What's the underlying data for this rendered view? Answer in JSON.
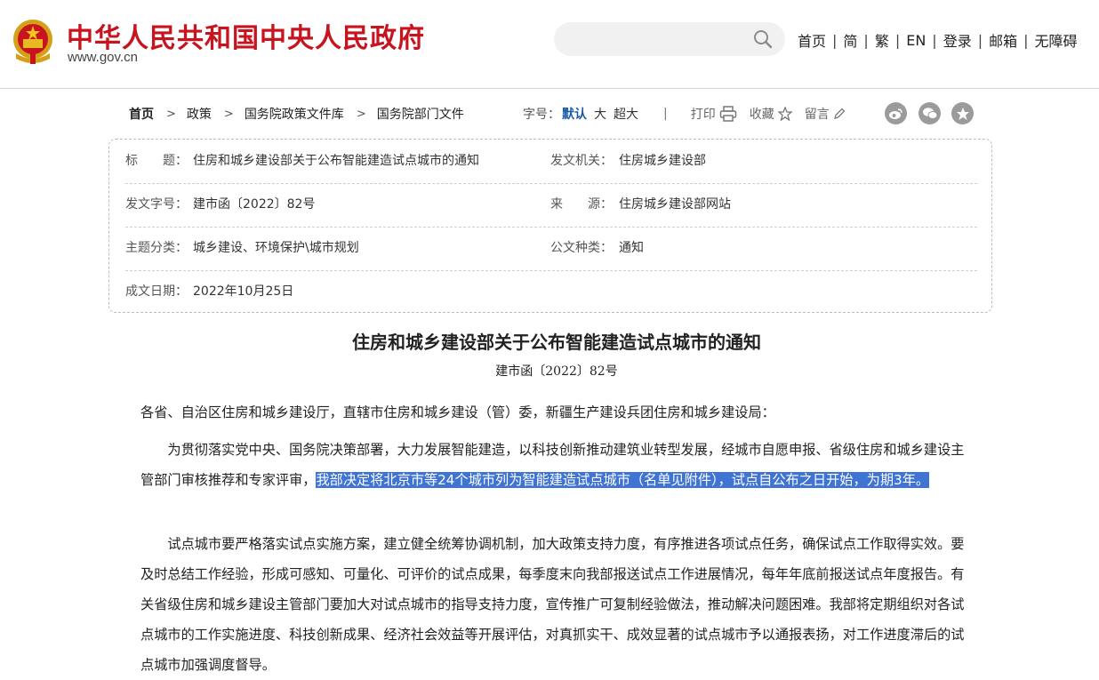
{
  "header": {
    "site_name": "中华人民共和国中央人民政府",
    "site_url": "www.gov.cn",
    "search": {
      "placeholder": ""
    },
    "nav": [
      "首页",
      "简",
      "繁",
      "EN",
      "登录",
      "邮箱",
      "无障碍"
    ]
  },
  "breadcrumb": [
    "首页",
    "政策",
    "国务院政策文件库",
    "国务院部门文件"
  ],
  "tools": {
    "font_label": "字号：",
    "font_selected": "默认",
    "font_options": [
      "大",
      "超大"
    ],
    "print": "打印",
    "favorite": "收藏",
    "comment": "留言"
  },
  "share_icons": [
    "weibo-icon",
    "wechat-icon",
    "star-icon"
  ],
  "info": {
    "title_label": "标　　题：",
    "title_value": "住房和城乡建设部关于公布智能建造试点城市的通知",
    "issuer_label": "发文机关：",
    "issuer_value": "住房城乡建设部",
    "doc_no_label": "发文字号：",
    "doc_no_value": "建市函〔2022〕82号",
    "source_label": "来　　源：",
    "source_value": "住房城乡建设部网站",
    "topic_label": "主题分类：",
    "topic_value": "城乡建设、环境保护\\城市规划",
    "type_label": "公文种类：",
    "type_value": "通知",
    "date_label": "成文日期：",
    "date_value": "2022年10月25日"
  },
  "article": {
    "title": "住房和城乡建设部关于公布智能建造试点城市的通知",
    "number": "建市函〔2022〕82号",
    "salutation": "各省、自治区住房和城乡建设厅，直辖市住房和城乡建设（管）委，新疆生产建设兵团住房和城乡建设局：",
    "p1_a": "　　为贯彻落实党中央、国务院决策部署，大力发展智能建造，以科技创新推动建筑业转型发展，经城市自愿申报、省级住房和城乡建设主管部门审核推荐和专家评审，",
    "p1_b": "我部决定将北京市等24个城市列为智能建造试点城市（名单见附件），试点自公布之日开始，为期3年。",
    "p2": "　　试点城市要严格落实试点实施方案，建立健全统筹协调机制，加大政策支持力度，有序推进各项试点任务，确保试点工作取得实效。要及时总结工作经验，形成可感知、可量化、可评价的试点成果，每季度末向我部报送试点工作进展情况，每年年底前报送试点年度报告。有关省级住房和城乡建设主管部门要加大对试点城市的指导支持力度，宣传推广可复制经验做法，推动解决问题困难。我部将定期组织对各试点城市的工作实施进度、科技创新成果、经济社会效益等开展评估，对真抓实干、成效显著的试点城市予以通报表扬，对工作进度滞后的试点城市加强调度督导。"
  },
  "colors": {
    "brand_red": "#c8141e",
    "highlight": "#3f73d4",
    "font_selected": "#1a5aa8"
  }
}
